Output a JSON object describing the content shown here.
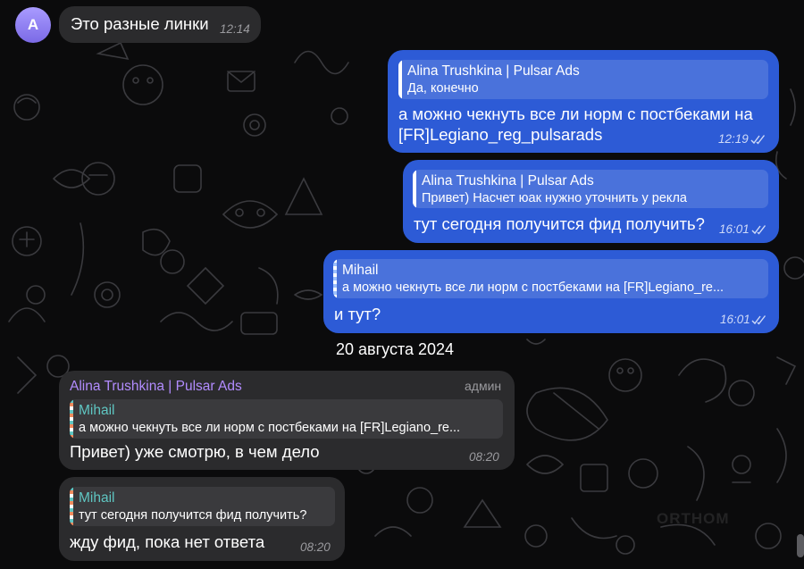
{
  "chat": {
    "avatar_letter": "A",
    "date_separator": "20 августа 2024",
    "watermark": "ORTHOM"
  },
  "messages": [
    {
      "id": "m1",
      "direction": "in",
      "text": "Это разные линки",
      "time": "12:14"
    },
    {
      "id": "m2",
      "direction": "out",
      "reply_name": "Alina Trushkina | Pulsar Ads",
      "reply_text": "Да, конечно",
      "text_line1": "а можно чекнуть все ли норм с постбеками на",
      "text_line2": "[FR]Legiano_reg_pulsarads",
      "time": "12:19",
      "status": "read"
    },
    {
      "id": "m3",
      "direction": "out",
      "reply_name": "Alina Trushkina | Pulsar Ads",
      "reply_text": "Привет) Насчет юак нужно уточнить у рекла",
      "text": "тут сегодня получится фид получить?",
      "time": "16:01",
      "status": "read"
    },
    {
      "id": "m4",
      "direction": "out",
      "reply_name": "Mihail",
      "reply_text": "а можно чекнуть все ли норм с постбеками на [FR]Legiano_re...",
      "text": "и тут?",
      "time": "16:01",
      "status": "read"
    },
    {
      "id": "m5",
      "direction": "in",
      "sender": "Alina Trushkina | Pulsar Ads",
      "role": "админ",
      "reply_name": "Mihail",
      "reply_text": "а можно чекнуть все ли норм с постбеками на [FR]Legiano_re...",
      "text": "Привет) уже смотрю, в чем дело",
      "time": "08:20"
    },
    {
      "id": "m6",
      "direction": "in",
      "reply_name": "Mihail",
      "reply_text": "тут сегодня получится фид получить?",
      "text": "жду фид, пока нет ответа",
      "time": "08:20"
    }
  ],
  "colors": {
    "background": "#0b0b0c",
    "incoming_bubble": "#2b2b2d",
    "outgoing_bubble": "#2d5bd6",
    "sender_name": "#b28cff",
    "reply_name_incoming": "#5fc6c2"
  }
}
